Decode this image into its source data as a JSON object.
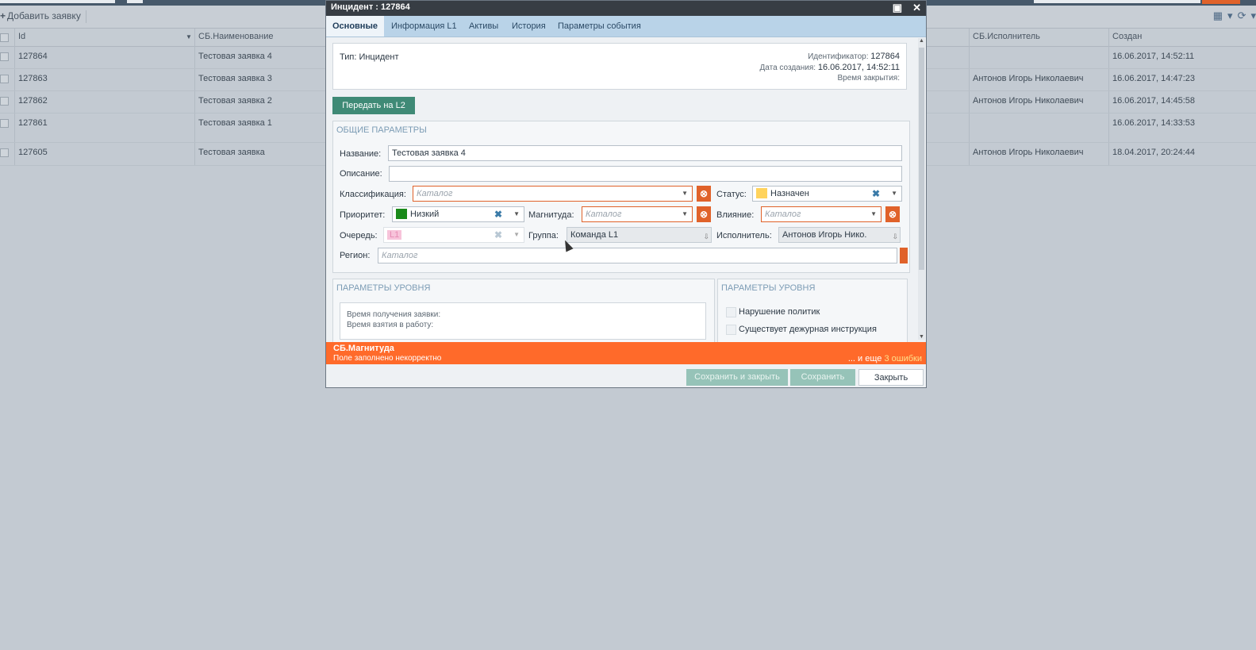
{
  "toolbar": {
    "add_label": "Добавить заявку"
  },
  "grid": {
    "columns": {
      "id": "Id",
      "name": "СБ.Наименование",
      "executor": "СБ.Исполнитель",
      "created": "Создан"
    },
    "rows": [
      {
        "id": "127864",
        "name": "Тестовая заявка 4",
        "executor": "",
        "created": "16.06.2017, 14:52:11"
      },
      {
        "id": "127863",
        "name": "Тестовая заявка 3",
        "executor": "Антонов Игорь Николаевич",
        "created": "16.06.2017, 14:47:23"
      },
      {
        "id": "127862",
        "name": "Тестовая заявка 2",
        "executor": "Антонов Игорь Николаевич",
        "created": "16.06.2017, 14:45:58"
      },
      {
        "id": "127861",
        "name": "Тестовая заявка 1",
        "executor": "",
        "created": "16.06.2017, 14:33:53"
      },
      {
        "id": "127605",
        "name": "Тестовая заявка",
        "executor": "Антонов Игорь Николаевич",
        "created": "18.04.2017, 20:24:44"
      }
    ]
  },
  "dialog": {
    "title": "Инцидент : 127864",
    "tabs": [
      "Основные",
      "Информация L1",
      "Активы",
      "История",
      "Параметры события"
    ],
    "info": {
      "type": "Тип: Инцидент",
      "id_label": "Идентификатор:",
      "id_value": "127864",
      "created_label": "Дата создания:",
      "created_value": "16.06.2017, 14:52:11",
      "closed_label": "Время закрытия:"
    },
    "l2_button": "Передать на L2",
    "general": {
      "title": "ОБЩИЕ ПАРАМЕТРЫ",
      "name_label": "Название:",
      "name_value": "Тестовая заявка 4",
      "desc_label": "Описание:",
      "desc_value": "",
      "class_label": "Классификация:",
      "class_placeholder": "Каталог",
      "status_label": "Статус:",
      "status_value": "Назначен",
      "priority_label": "Приоритет:",
      "priority_value": "Низкий",
      "magnitude_label": "Магнитуда:",
      "magnitude_placeholder": "Каталог",
      "impact_label": "Влияние:",
      "impact_placeholder": "Каталог",
      "queue_label": "Очередь:",
      "queue_value": "L1",
      "group_label": "Группа:",
      "group_value": "Команда L1",
      "executor_label": "Исполнитель:",
      "executor_value": "Антонов Игорь Нико.",
      "region_label": "Регион:",
      "region_placeholder": "Каталог"
    },
    "level_left": {
      "title": "ПАРАМЕТРЫ УРОВНЯ",
      "received": "Время получения заявки:",
      "taken": "Время взятия в работу:"
    },
    "level_right": {
      "title": "ПАРАМЕТРЫ УРОВНЯ",
      "check1": "Нарушение политик",
      "check2": "Существует дежурная инструкция"
    },
    "error": {
      "field": "СБ.Магнитуда",
      "message": "Поле заполнено некорректно",
      "more_prefix": "... и еще",
      "more_count": "3 ошибки"
    },
    "buttons": {
      "save_close": "Сохранить и закрыть",
      "save": "Сохранить",
      "close": "Закрыть"
    }
  },
  "colors": {
    "status": "#ffd35c",
    "priority": "#1a8a1a",
    "queue": "#f7c3da",
    "error": "#ff6a2a",
    "accent": "#3f8a76"
  }
}
